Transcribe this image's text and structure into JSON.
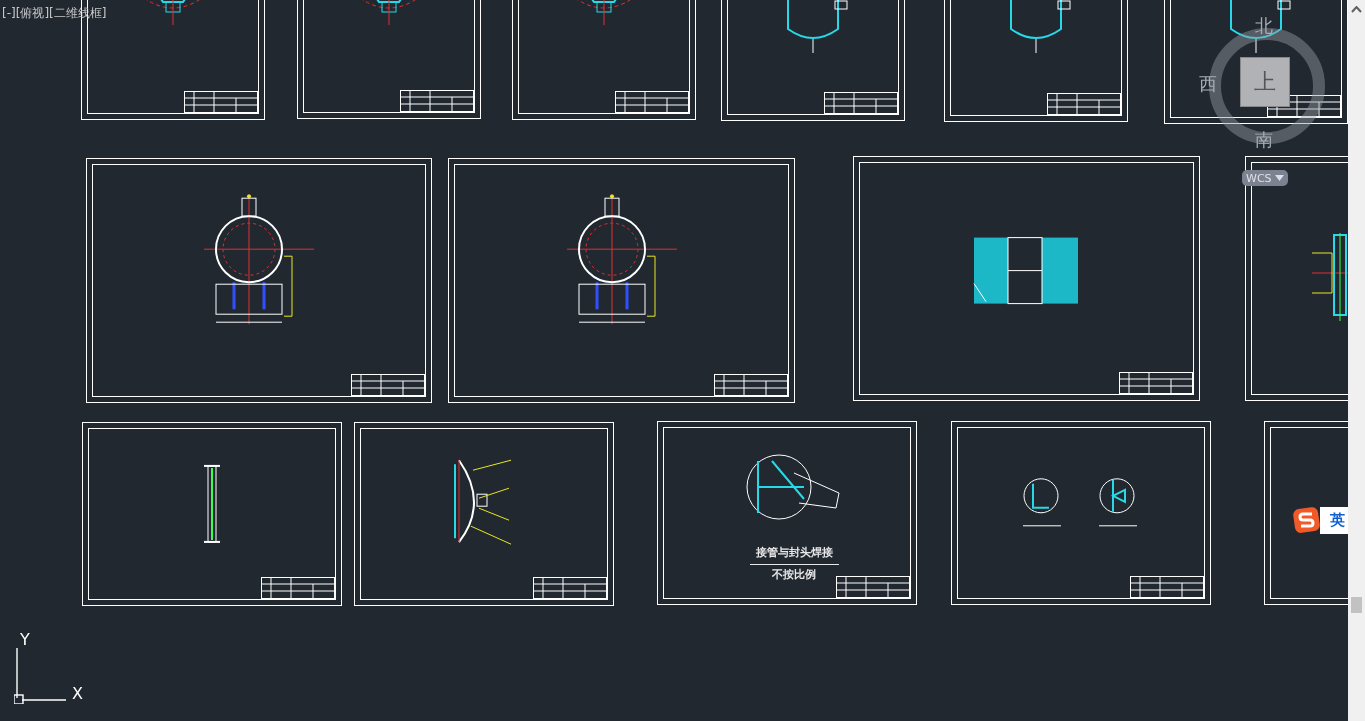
{
  "view_label": "[-][俯视][二维线框]",
  "sheets": [
    {
      "kind": "flange"
    },
    {
      "kind": "flange"
    },
    {
      "kind": "flange"
    },
    {
      "kind": "vessel"
    },
    {
      "kind": "vessel"
    },
    {
      "kind": "vessel"
    },
    {
      "kind": "front"
    },
    {
      "kind": "front"
    },
    {
      "kind": "tubes"
    },
    {
      "kind": "side"
    },
    {
      "kind": "pipe"
    },
    {
      "kind": "head"
    },
    {
      "kind": "detail",
      "caption": "接管与封头焊接",
      "note": "不按比例"
    },
    {
      "kind": "details2"
    },
    {
      "kind": "blank"
    }
  ],
  "viewcube": {
    "north": "北",
    "west": "西",
    "south": "南",
    "top": "上"
  },
  "wcs_menu": "WCS",
  "ucs": {
    "x": "X",
    "y": "Y"
  },
  "ime": {
    "mode": "英"
  }
}
